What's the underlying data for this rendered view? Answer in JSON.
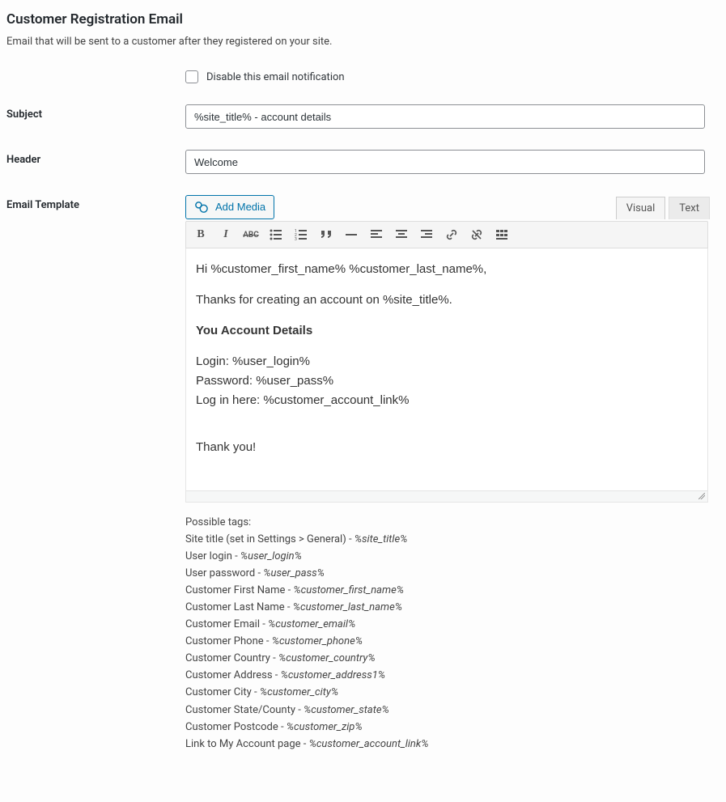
{
  "heading": "Customer Registration Email",
  "description": "Email that will be sent to a customer after they registered on your site.",
  "disable": {
    "label": "Disable this email notification"
  },
  "subject": {
    "label": "Subject",
    "value": "%site_title% - account details"
  },
  "header": {
    "label": "Header",
    "value": "Welcome"
  },
  "template": {
    "label": "Email Template",
    "add_media": "Add Media",
    "tabs": {
      "visual": "Visual",
      "text": "Text"
    },
    "body": {
      "line1": "Hi %customer_first_name% %customer_last_name%,",
      "line2": "Thanks for creating an account on %site_title%.",
      "line3": "You Account Details",
      "line4": "Login: %user_login%",
      "line5": "Password: %user_pass%",
      "line6": "Log in here: %customer_account_link%",
      "line7": "Thank you!"
    }
  },
  "tags": {
    "intro": "Possible tags:",
    "items": [
      {
        "label": "Site title (set in Settings > General) - ",
        "ph": "%site_title%"
      },
      {
        "label": "User login - ",
        "ph": "%user_login%"
      },
      {
        "label": "User password - ",
        "ph": "%user_pass%"
      },
      {
        "label": "Customer First Name - ",
        "ph": "%customer_first_name%"
      },
      {
        "label": "Customer Last Name - ",
        "ph": "%customer_last_name%"
      },
      {
        "label": "Customer Email - ",
        "ph": "%customer_email%"
      },
      {
        "label": "Customer Phone - ",
        "ph": "%customer_phone%"
      },
      {
        "label": "Customer Country - ",
        "ph": "%customer_country%"
      },
      {
        "label": "Customer Address - ",
        "ph": "%customer_address1%"
      },
      {
        "label": "Customer City - ",
        "ph": "%customer_city%"
      },
      {
        "label": "Customer State/County - ",
        "ph": "%customer_state%"
      },
      {
        "label": "Customer Postcode - ",
        "ph": "%customer_zip%"
      },
      {
        "label": "Link to My Account page - ",
        "ph": "%customer_account_link%"
      }
    ]
  }
}
